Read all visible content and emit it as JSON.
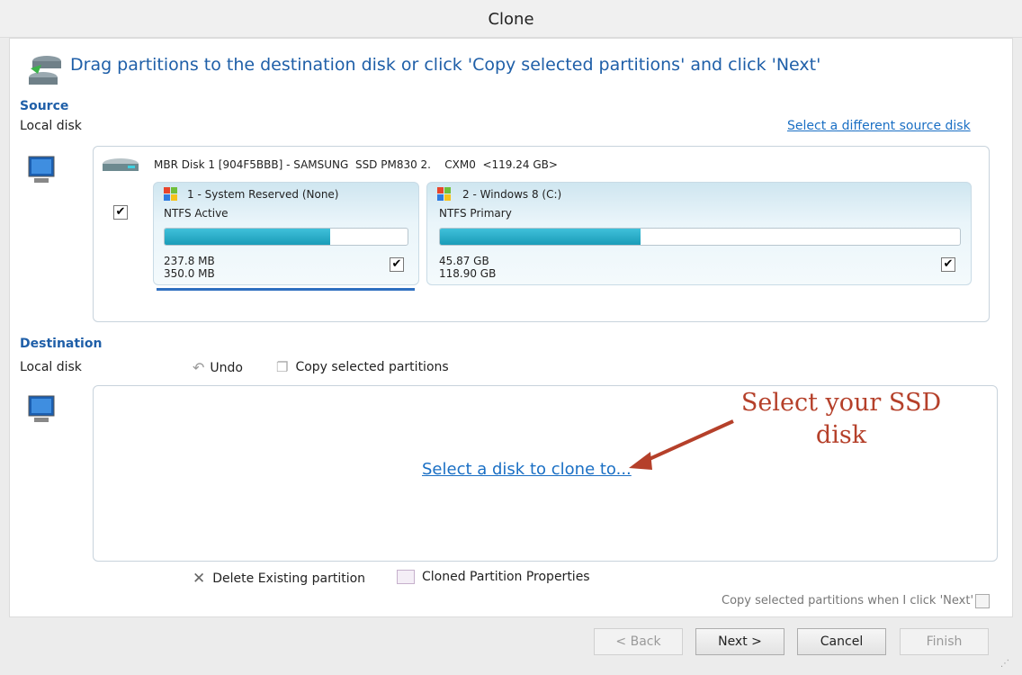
{
  "window": {
    "title": "Clone"
  },
  "header": {
    "instruction": "Drag partitions to the destination disk or click 'Copy selected partitions' and click 'Next'"
  },
  "source": {
    "heading": "Source",
    "sublabel": "Local disk",
    "change_link": "Select a different source disk",
    "disk": {
      "label": "MBR Disk 1 [904F5BBB] - SAMSUNG  SSD PM830 2.    CXM0  <119.24 GB>",
      "checked": true,
      "partitions": [
        {
          "name": "1 - System Reserved (None)",
          "type": "NTFS Active",
          "used": "237.8 MB",
          "total": "350.0 MB",
          "used_fraction": 0.68,
          "checked": true
        },
        {
          "name": "2 - Windows 8 (C:)",
          "type": "NTFS Primary",
          "used": "45.87 GB",
          "total": "118.90 GB",
          "used_fraction": 0.386,
          "checked": true
        }
      ]
    }
  },
  "destination": {
    "heading": "Destination",
    "sublabel": "Local disk",
    "undo": "Undo",
    "copy": "Copy selected partitions",
    "select_link": "Select a disk to clone to..."
  },
  "annotation": {
    "line1": "Select your SSD",
    "line2": "disk",
    "color": "#b5402a"
  },
  "actions": {
    "delete": "Delete Existing partition",
    "properties": "Cloned Partition Properties",
    "copy_on_next": "Copy selected partitions when I click 'Next'",
    "copy_on_next_checked": false
  },
  "buttons": {
    "back": "< Back",
    "next": "Next >",
    "cancel": "Cancel",
    "finish": "Finish"
  }
}
